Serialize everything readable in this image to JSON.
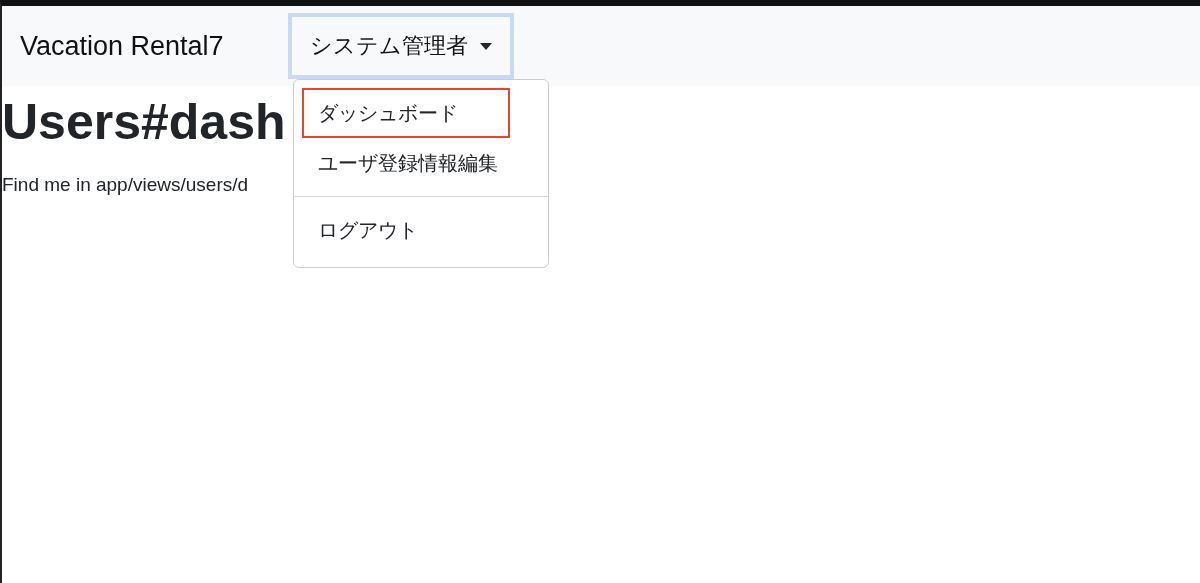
{
  "navbar": {
    "brand": "Vacation Rental7",
    "dropdown": {
      "label": "システム管理者",
      "expanded": true,
      "items": [
        {
          "kind": "item",
          "label": "ダッシュボード",
          "highlighted": true
        },
        {
          "kind": "item",
          "label": "ユーザ登録情報編集",
          "highlighted": false
        },
        {
          "kind": "divider"
        },
        {
          "kind": "item",
          "label": "ログアウト",
          "highlighted": false
        }
      ]
    }
  },
  "content": {
    "heading": "Users#dash",
    "text": "Find me in app/views/users/d"
  }
}
